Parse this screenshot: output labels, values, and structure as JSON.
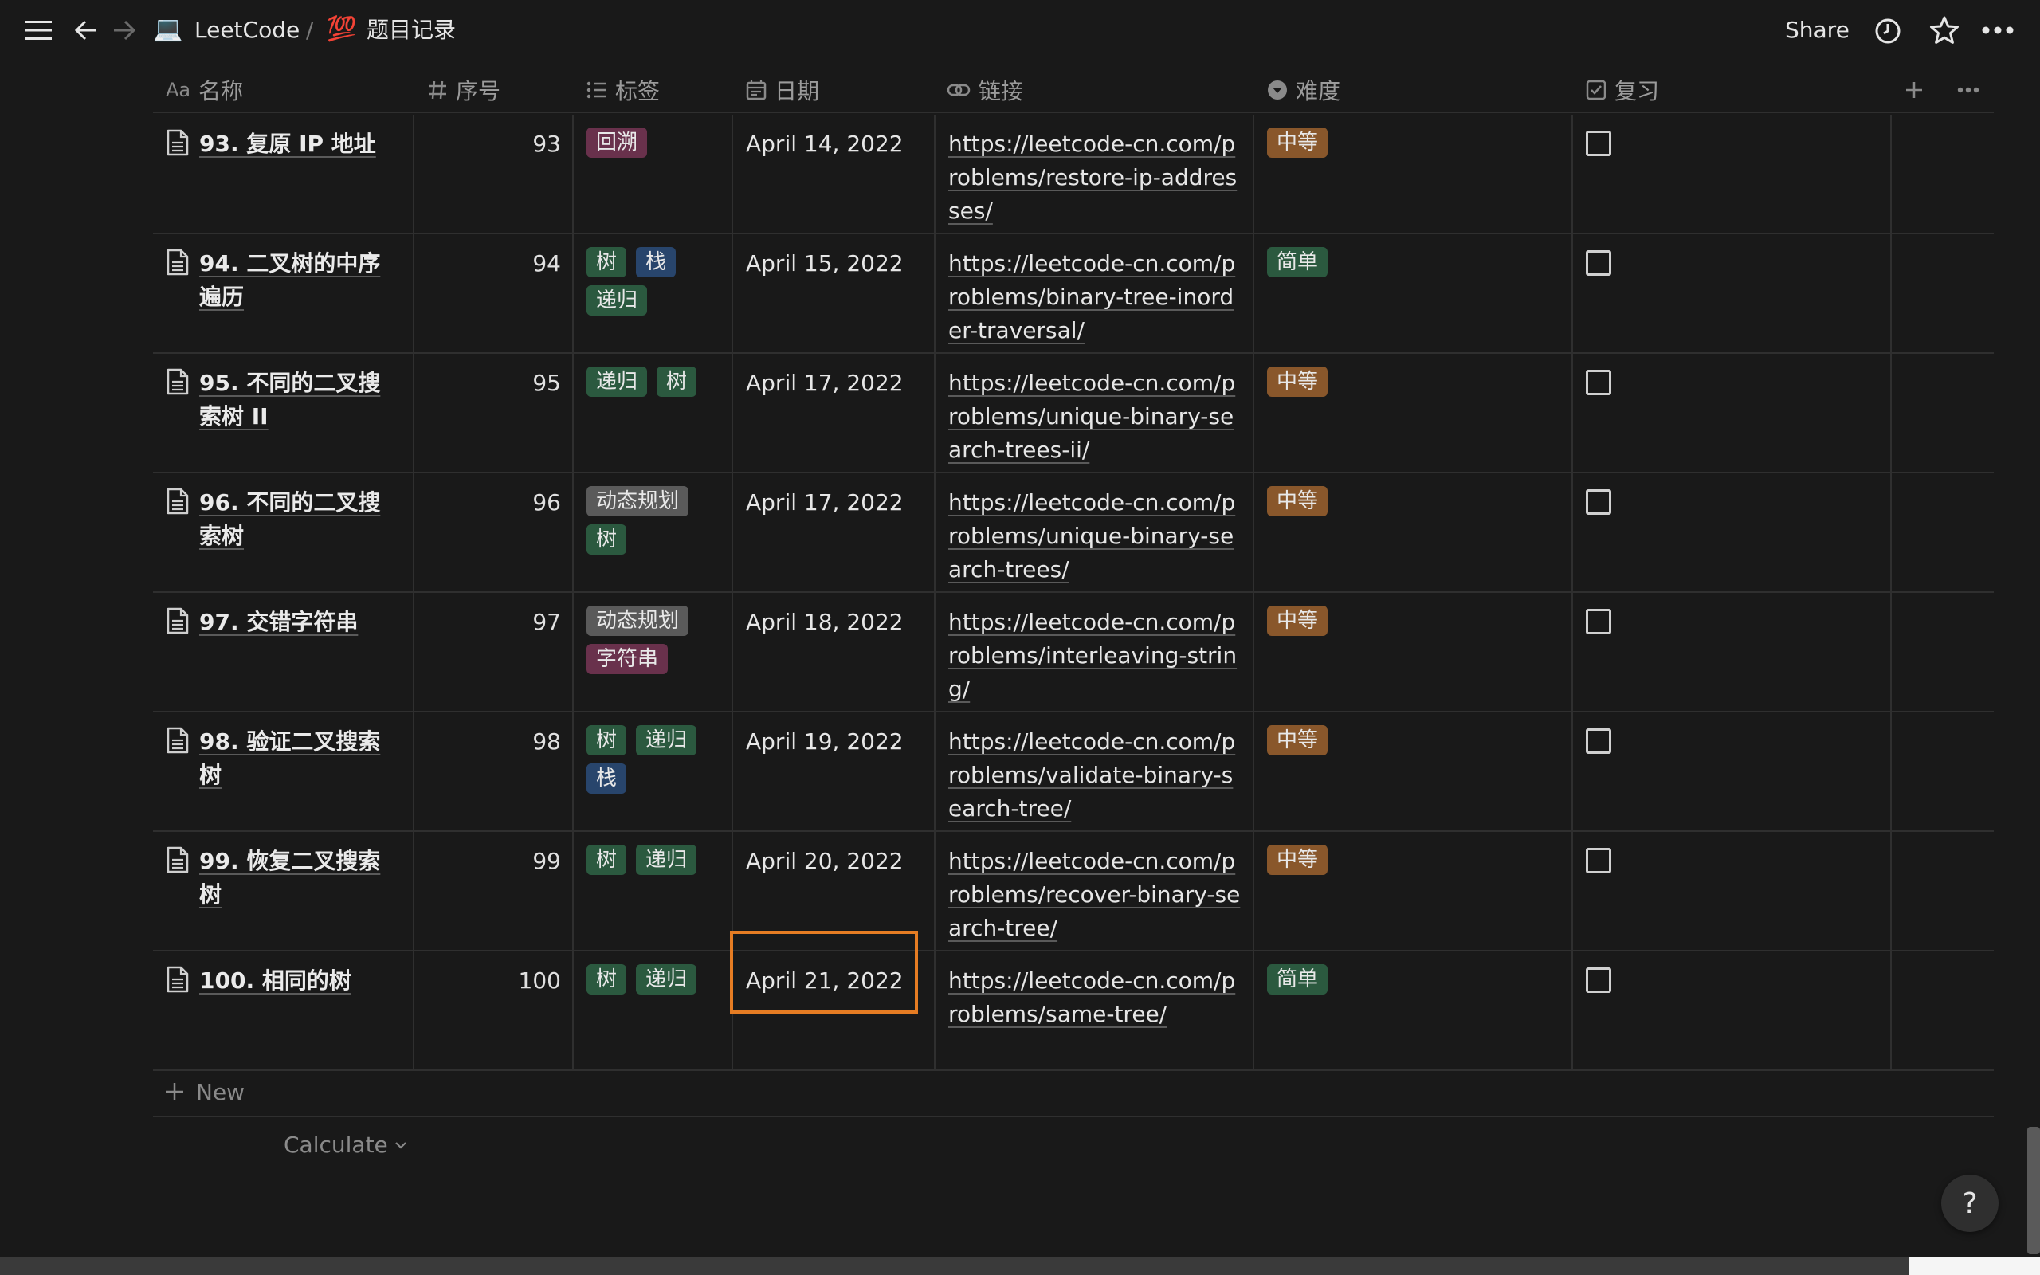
{
  "topbar": {
    "workspace": "LeetCode",
    "workspace_emoji": "💻",
    "separator": "/",
    "page_emoji": "💯",
    "page_title": "题目记录",
    "share": "Share"
  },
  "columns": {
    "name": "名称",
    "number": "序号",
    "tags": "标签",
    "date": "日期",
    "link": "链接",
    "difficulty": "难度",
    "review": "复习",
    "name_prefix_icon": "Aa"
  },
  "colors": {
    "background": "#191919",
    "tag_orange": "#89572b",
    "tag_green": "#2b593f",
    "tag_blue": "#28456c",
    "tag_gray": "#5a5a5a",
    "tag_purple": "#69314c",
    "highlight": "#e57c23"
  },
  "rows": [
    {
      "name": "93. 复原 IP 地址",
      "number": "93",
      "tags": [
        {
          "label": "回溯",
          "color": "purple"
        }
      ],
      "date": "April 14, 2022",
      "link": "https://leetcode-cn.com/problems/restore-ip-addresses/",
      "difficulty": "中等",
      "difficulty_color": "orange",
      "review": false
    },
    {
      "name": "94. 二叉树的中序遍历",
      "number": "94",
      "tags": [
        {
          "label": "树",
          "color": "green"
        },
        {
          "label": "栈",
          "color": "blue"
        },
        {
          "label": "递归",
          "color": "green"
        }
      ],
      "date": "April 15, 2022",
      "link": "https://leetcode-cn.com/problems/binary-tree-inorder-traversal/",
      "difficulty": "简单",
      "difficulty_color": "green",
      "review": false
    },
    {
      "name": "95. 不同的二叉搜索树 II",
      "number": "95",
      "tags": [
        {
          "label": "递归",
          "color": "green"
        },
        {
          "label": "树",
          "color": "green"
        }
      ],
      "date": "April 17, 2022",
      "link": "https://leetcode-cn.com/problems/unique-binary-search-trees-ii/",
      "difficulty": "中等",
      "difficulty_color": "orange",
      "review": false
    },
    {
      "name": "96. 不同的二叉搜索树",
      "number": "96",
      "tags": [
        {
          "label": "动态规划",
          "color": "gray"
        },
        {
          "label": "树",
          "color": "green"
        }
      ],
      "date": "April 17, 2022",
      "link": "https://leetcode-cn.com/problems/unique-binary-search-trees/",
      "difficulty": "中等",
      "difficulty_color": "orange",
      "review": false
    },
    {
      "name": "97. 交错字符串",
      "number": "97",
      "tags": [
        {
          "label": "动态规划",
          "color": "gray"
        },
        {
          "label": "字符串",
          "color": "purple"
        }
      ],
      "date": "April 18, 2022",
      "link": "https://leetcode-cn.com/problems/interleaving-string/",
      "difficulty": "中等",
      "difficulty_color": "orange",
      "review": false
    },
    {
      "name": "98. 验证二叉搜索树",
      "number": "98",
      "tags": [
        {
          "label": "树",
          "color": "green"
        },
        {
          "label": "递归",
          "color": "green"
        },
        {
          "label": "栈",
          "color": "blue"
        }
      ],
      "date": "April 19, 2022",
      "link": "https://leetcode-cn.com/problems/validate-binary-search-tree/",
      "difficulty": "中等",
      "difficulty_color": "orange",
      "review": false
    },
    {
      "name": "99. 恢复二叉搜索树",
      "number": "99",
      "tags": [
        {
          "label": "树",
          "color": "green"
        },
        {
          "label": "递归",
          "color": "green"
        }
      ],
      "date": "April 20, 2022",
      "link": "https://leetcode-cn.com/problems/recover-binary-search-tree/",
      "difficulty": "中等",
      "difficulty_color": "orange",
      "review": false
    },
    {
      "name": "100. 相同的树",
      "number": "100",
      "tags": [
        {
          "label": "树",
          "color": "green"
        },
        {
          "label": "递归",
          "color": "green"
        }
      ],
      "date": "April 21, 2022",
      "link": "https://leetcode-cn.com/problems/same-tree/",
      "difficulty": "简单",
      "difficulty_color": "green",
      "review": false,
      "highlighted": true
    }
  ],
  "footer": {
    "new_label": "New",
    "calculate_label": "Calculate",
    "help_label": "?"
  }
}
